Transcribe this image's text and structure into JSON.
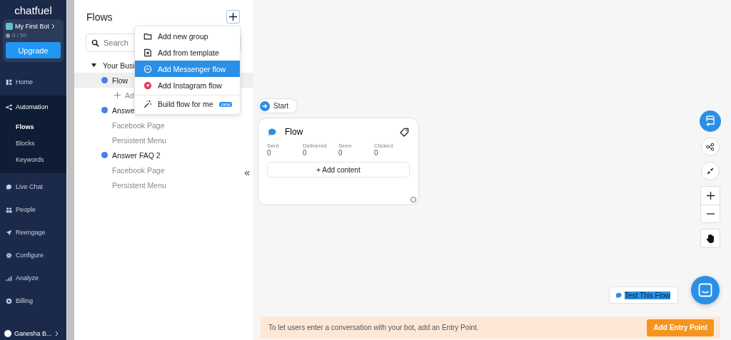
{
  "sidebar": {
    "logo": "chatfuel",
    "bot": {
      "name": "My First Bot",
      "usage": "0 / 50",
      "upgrade": "Upgrade"
    },
    "items": [
      {
        "label": "Home",
        "kind": "home",
        "selected": false
      },
      {
        "label": "Automation",
        "kind": "automation",
        "selected": true,
        "children": [
          {
            "label": "Flows",
            "selected": true
          },
          {
            "label": "Blocks",
            "selected": false
          },
          {
            "label": "Keywords",
            "selected": false
          }
        ]
      },
      {
        "label": "Live Chat",
        "kind": "chat",
        "selected": false
      },
      {
        "label": "People",
        "kind": "people",
        "selected": false
      },
      {
        "label": "Reengage",
        "kind": "send",
        "selected": false
      },
      {
        "label": "Configure",
        "kind": "gear",
        "selected": false
      },
      {
        "label": "Analyze",
        "kind": "bars",
        "selected": false
      },
      {
        "label": "Billing",
        "kind": "billing",
        "selected": false
      }
    ],
    "user": "Ganesha B..."
  },
  "flows_panel": {
    "title": "Flows",
    "search": {
      "placeholder": "Search"
    },
    "tree": [
      {
        "label": "Your Busi",
        "expanded": true,
        "children": [
          {
            "kind": "flow",
            "label": "Flow",
            "selected": true
          },
          {
            "kind": "add",
            "label": "Ad"
          },
          {
            "kind": "flow",
            "label": "Answe",
            "selected": false,
            "children": [
              {
                "label": "Facebook Page"
              },
              {
                "label": "Persistent Menu"
              }
            ]
          },
          {
            "kind": "flow",
            "label": "Answer FAQ 2",
            "selected": false,
            "children": [
              {
                "label": "Facebook Page"
              },
              {
                "label": "Persistent Menu"
              }
            ]
          }
        ]
      }
    ],
    "collapse": "«"
  },
  "add_menu": {
    "items": [
      {
        "kind": "folder",
        "label": "Add new group",
        "selected": false
      },
      {
        "kind": "template",
        "label": "Add from template",
        "selected": false
      },
      {
        "kind": "messenger",
        "label": "Add Messenger flow",
        "selected": true
      },
      {
        "kind": "instagram",
        "label": "Add Instagram flow",
        "selected": false
      },
      {
        "kind": "magic",
        "label": "Build flow for me",
        "badge": "new",
        "selected": false
      }
    ]
  },
  "canvas": {
    "start": "Start",
    "card": {
      "title": "Flow",
      "stats": [
        {
          "label": "Sent",
          "value": "0"
        },
        {
          "label": "Delivered",
          "value": "0"
        },
        {
          "label": "Seen",
          "value": "0"
        },
        {
          "label": "Clicked",
          "value": "0"
        }
      ],
      "add": "+ Add content"
    },
    "test_button": "Test This Flow",
    "banner": {
      "text": "To let users enter a conversation with your bot, add an Entry Point.",
      "button": "Add Entry Point"
    }
  }
}
